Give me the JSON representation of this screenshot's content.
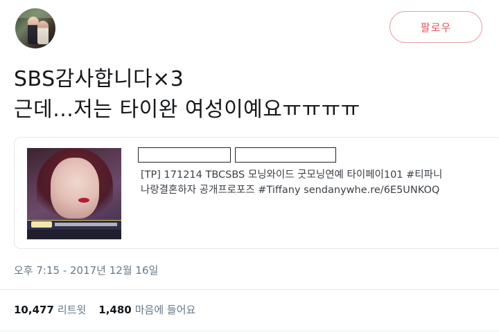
{
  "header": {
    "follow_label": "팔로우"
  },
  "tweet": {
    "line1": "SBS감사합니다×3",
    "line2": "근데...저는 타이완 여성이예요ㅠㅠㅠㅠ"
  },
  "card": {
    "desc_line1": "[TP] 171214 TBCSBS 모닝와이드 굿모닝연예 타이페이101 #티파니",
    "desc_line2": "나랑결혼하자 공개프로포즈 #Tiffany sendanywhe.re/6E5UNKOQ"
  },
  "meta": {
    "timestamp": "오후 7:15 - 2017년 12월 16일"
  },
  "stats": {
    "retweets_count": "10,477",
    "retweets_label": "리트윗",
    "likes_count": "1,480",
    "likes_label": "마음에 들어요"
  },
  "colors": {
    "accent": "#e0545f",
    "muted": "#657786"
  }
}
